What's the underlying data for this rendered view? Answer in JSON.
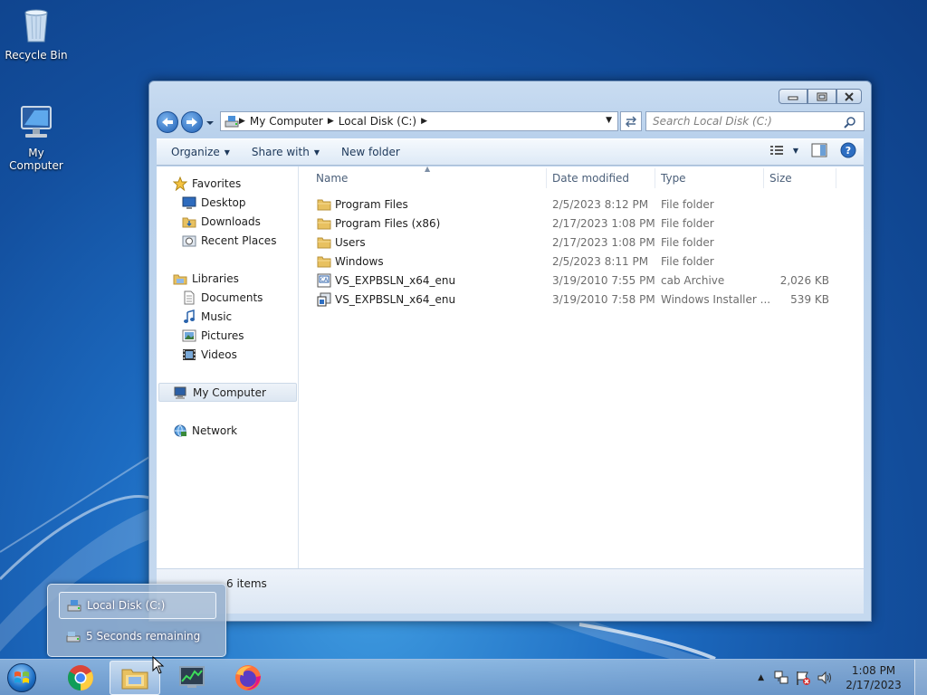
{
  "desktop": {
    "icons": [
      {
        "label": "Recycle Bin",
        "icon": "recycle-bin-icon"
      },
      {
        "label": "My Computer",
        "icon": "computer-icon"
      }
    ]
  },
  "explorer": {
    "address": {
      "crumbs": [
        "My Computer",
        "Local Disk (C:)"
      ]
    },
    "search_placeholder": "Search Local Disk (C:)",
    "toolbar": {
      "organize": "Organize",
      "share_with": "Share with",
      "new_folder": "New folder"
    },
    "nav": {
      "favorites": "Favorites",
      "desktop": "Desktop",
      "downloads": "Downloads",
      "recent_places": "Recent Places",
      "libraries": "Libraries",
      "documents": "Documents",
      "music": "Music",
      "pictures": "Pictures",
      "videos": "Videos",
      "my_computer": "My Computer",
      "network": "Network"
    },
    "columns": {
      "name": "Name",
      "date": "Date modified",
      "type": "Type",
      "size": "Size"
    },
    "files": [
      {
        "name": "Program Files",
        "date": "2/5/2023 8:12 PM",
        "type": "File folder",
        "size": "",
        "icon": "folder-icon"
      },
      {
        "name": "Program Files (x86)",
        "date": "2/17/2023 1:08 PM",
        "type": "File folder",
        "size": "",
        "icon": "folder-icon"
      },
      {
        "name": "Users",
        "date": "2/17/2023 1:08 PM",
        "type": "File folder",
        "size": "",
        "icon": "folder-icon"
      },
      {
        "name": "Windows",
        "date": "2/5/2023 8:11 PM",
        "type": "File folder",
        "size": "",
        "icon": "folder-icon"
      },
      {
        "name": "VS_EXPBSLN_x64_enu",
        "date": "3/19/2010 7:55 PM",
        "type": "cab Archive",
        "size": "2,026 KB",
        "icon": "cab-file-icon"
      },
      {
        "name": "VS_EXPBSLN_x64_enu",
        "date": "3/19/2010 7:58 PM",
        "type": "Windows Installer ...",
        "size": "539 KB",
        "icon": "installer-file-icon"
      }
    ],
    "status": "6 items"
  },
  "thumbnail": {
    "item1": "Local Disk (C:)",
    "item2": "5 Seconds remaining"
  },
  "taskbar": {
    "apps": [
      "chrome-icon",
      "explorer-icon",
      "task-manager-icon",
      "firefox-icon"
    ],
    "clock_time": "1:08 PM",
    "clock_date": "2/17/2023"
  },
  "colors": {
    "accent": "#1e395b",
    "folder": "#e8c160",
    "selection": "#dde7f2"
  }
}
